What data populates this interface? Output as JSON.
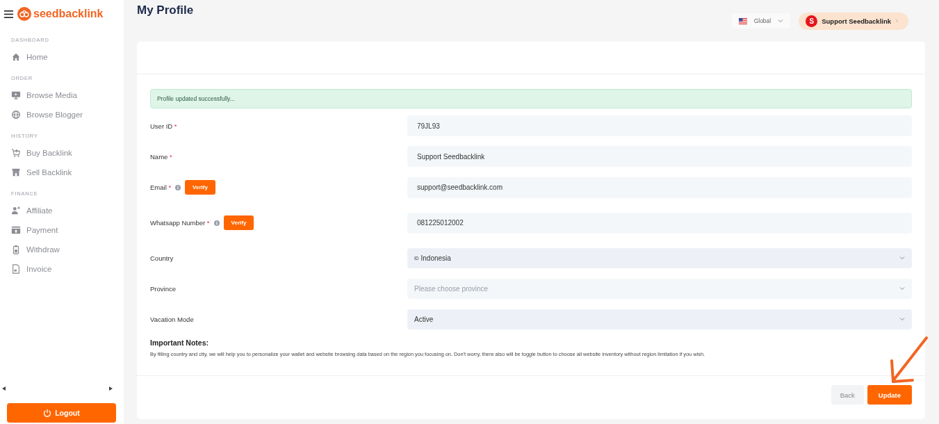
{
  "sidebar": {
    "brand": "seedbacklink",
    "sections": [
      {
        "title": "DASHBOARD",
        "items": [
          {
            "label": "Home"
          }
        ]
      },
      {
        "title": "ORDER",
        "items": [
          {
            "label": "Browse Media"
          },
          {
            "label": "Browse Blogger"
          }
        ]
      },
      {
        "title": "HISTORY",
        "items": [
          {
            "label": "Buy Backlink"
          },
          {
            "label": "Sell Backlink"
          }
        ]
      },
      {
        "title": "FINANCE",
        "items": [
          {
            "label": "Affiliate"
          },
          {
            "label": "Payment"
          },
          {
            "label": "Withdraw"
          },
          {
            "label": "Invoice"
          }
        ]
      }
    ],
    "logout": "Logout"
  },
  "header": {
    "title": "My Profile",
    "region": "Global",
    "user": {
      "initial": "S",
      "name": "Support Seedbacklink"
    }
  },
  "alert": "Profile updated successfully...",
  "fields": [
    {
      "label": "User ID",
      "mark": "*",
      "kind": "text",
      "value": "79JL93",
      "info": false
    },
    {
      "label": "Name",
      "mark": "*",
      "kind": "text",
      "value": "Support Seedbacklink",
      "info": false
    },
    {
      "label": "Email",
      "mark": "*",
      "kind": "text",
      "value": "support@seedbacklink.com",
      "info": true,
      "action": "Verify"
    },
    {
      "label": "Whatsapp Number",
      "mark": "*",
      "kind": "text",
      "value": "081225012002",
      "info": true,
      "action": "Verify"
    },
    {
      "label": "Country",
      "kind": "select",
      "code": "ID",
      "value": "Indonesia",
      "info": false
    },
    {
      "label": "Province",
      "kind": "select",
      "placeholder": "Please choose province",
      "info": false
    },
    {
      "label": "Vacation Mode",
      "kind": "select",
      "value": "Active",
      "info": false
    }
  ],
  "notes": {
    "title": "Important Notes:",
    "text": "By filling country and city, we will help you to personalize your wallet and website browsing data based on the region you focusing on. Don't worry, there also will be toggle button to choose all website inventory without region limitation if you wish."
  },
  "buttons": [
    {
      "label": "Back",
      "kind": "secondary"
    },
    {
      "label": "Update",
      "kind": "primary"
    }
  ]
}
